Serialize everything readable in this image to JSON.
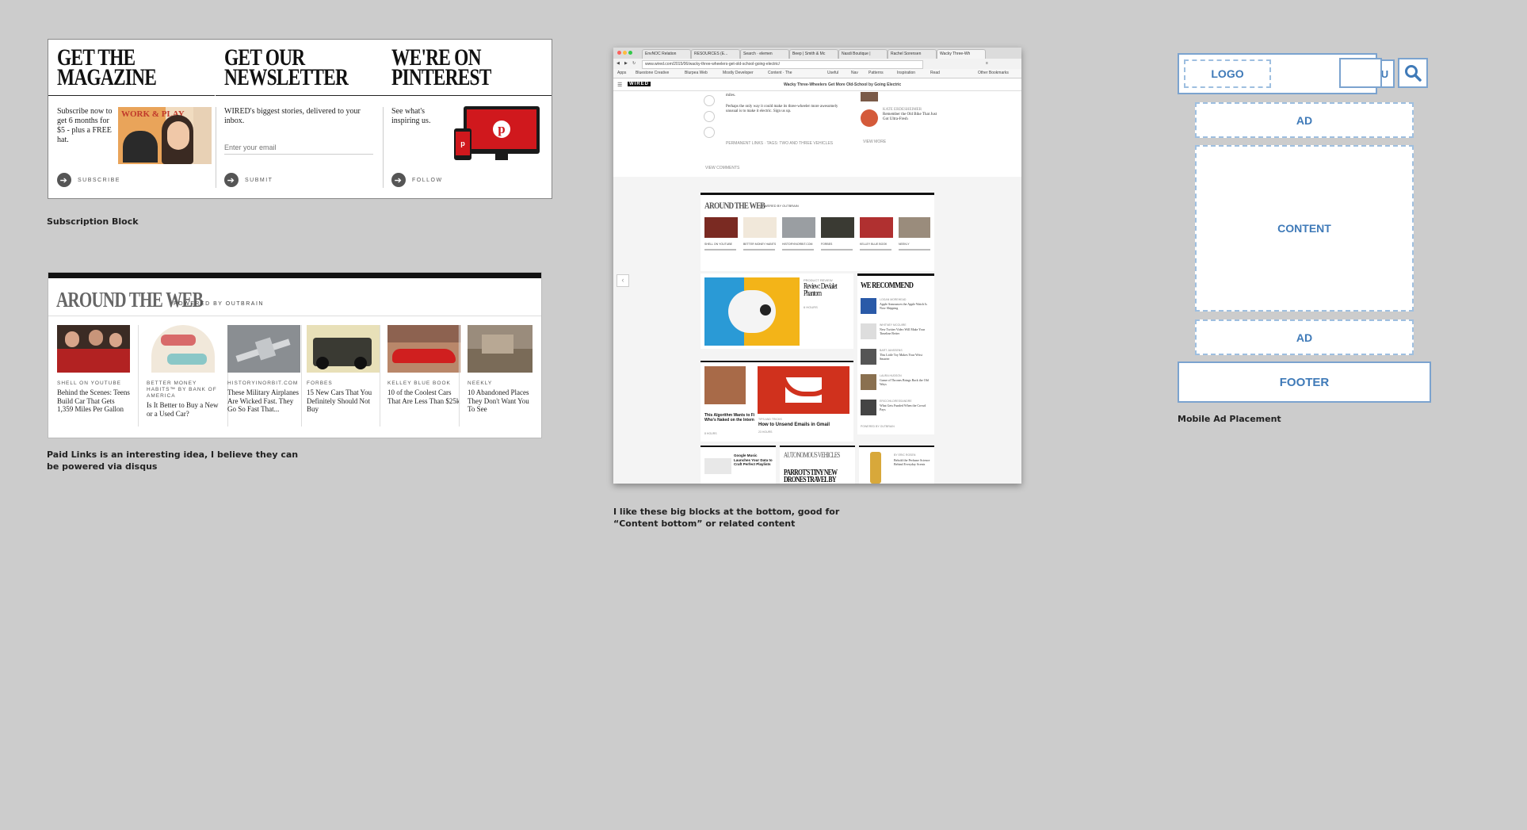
{
  "subscription_block": {
    "columns": [
      {
        "heading_line1": "GET THE",
        "heading_line2": "MAGAZINE",
        "text": "Subscribe now to get 6 months for $5 - plus a FREE hat.",
        "action": "SUBSCRIBE"
      },
      {
        "heading_line1": "GET OUR",
        "heading_line2": "NEWSLETTER",
        "text": "WIRED's biggest stories, delivered to your inbox.",
        "placeholder": "Enter your email",
        "action": "SUBMIT"
      },
      {
        "heading_line1": "WE'RE ON",
        "heading_line2": "PINTEREST",
        "text": "See what's inspiring us.",
        "action": "FOLLOW"
      }
    ],
    "magazine_cover_text": "WORK & PLAY",
    "caption": "Subscription Block"
  },
  "around_the_web": {
    "title": "AROUND THE WEB",
    "powered_by": "POWERED BY OUTBRAIN",
    "items": [
      {
        "source": "SHELL ON YOUTUBE",
        "title": "Behind the Scenes: Teens Build Car That Gets 1,359 Miles Per Gallon"
      },
      {
        "source": "BETTER MONEY HABITS™ BY BANK OF AMERICA",
        "title": "Is It Better to Buy a New or a Used Car?"
      },
      {
        "source": "HISTORYINORBIT.COM",
        "title": "These Military Airplanes Are Wicked Fast. They Go So Fast That..."
      },
      {
        "source": "FORBES",
        "title": "15 New Cars That You Definitely Should Not Buy"
      },
      {
        "source": "KELLEY BLUE BOOK",
        "title": "10 of the Coolest Cars That Are Less Than $25k"
      },
      {
        "source": "NEEKLY",
        "title": "10 Abandoned Places They Don't Want You To See"
      }
    ],
    "caption_line1": "Paid Links is an interesting idea, I believe they can",
    "caption_line2": "be powered via disqus"
  },
  "browser_screenshot": {
    "tabs": [
      "EnvNOC Relation",
      "RESOURCES (E...",
      "Search · elemen",
      "Beep | Smith & Mc",
      "Nasdi Boutique |",
      "Rachel Sorensen",
      "Wacky Three-Wh"
    ],
    "url": "www.wired.com/2015/06/wacky-three-wheelers-get-old-school-going-electric/",
    "bookmarks": [
      "Apps",
      "Bluestone Creative",
      "Blurpea Web",
      "Mostly Developer",
      "Content · The",
      "Useful",
      "Nav",
      "Patterns",
      "Inspiration",
      "Read",
      "Other Bookmarks"
    ],
    "site_logo": "WIRED",
    "article_title": "Wacky Three-Wheelers Get More Old-School by Going Electric",
    "body_text_1": "miles.",
    "body_text_2": "Perhaps the only way it could make its three-wheeler more awesomely unusual is to make it electric. Sign us up.",
    "tags": "PERMANENT LINKS · TAGS: TWO AND THREE VEHICLES",
    "view_comments": "VIEW COMMENTS",
    "view_more": "VIEW MORE",
    "side_list": [
      {
        "kicker": "GEAR",
        "title": "Maybe We'll Have Trek's Prototype Bike Pedal Better"
      },
      {
        "kicker": "KATE ERDESHEIMER",
        "title": "Remember the Old Bike That Just Got Ultra-Fresh"
      }
    ],
    "atw_title": "AROUND THE WEB",
    "atw_powered": "POWERED BY OUTBRAIN",
    "atw_sources": [
      "SHELL ON YOUTUBE",
      "BETTER MONEY HABITS",
      "HISTORYINORBIT.COM",
      "FORBES",
      "KELLEY BLUE BOOK",
      "NEEKLY"
    ],
    "feature_kicker": "PRODUCT REVIEW",
    "feature_title": "Review: Devialet Phantom",
    "feature_time": "6 HOURS",
    "we_recommend_title": "WE RECOMMEND",
    "we_recommend": [
      {
        "kicker": "LOGAN MOREHEAD",
        "title": "Apple Announces the Apple Watch Is Now Shipping"
      },
      {
        "kicker": "WHITNEY MCGUIRE",
        "title": "New Twitter Video Will Make Your Timeline Better"
      },
      {
        "kicker": "BART JANSSENS",
        "title": "This Little Toy Makes Your Wrist Smarter"
      },
      {
        "kicker": "LAURA HUDSON",
        "title": "Game of Thrones Brings Back the Old Ways"
      },
      {
        "kicker": "ERICCHILDRESSANDRE",
        "title": "What Gets Funded When the Crowd Pays"
      }
    ],
    "powered_small": "POWERED BY OUTBRAIN",
    "card_algorithm_title": "This Algorithm Wants to Find Who's Naked on the Internet",
    "card_algorithm_time": "8 HOURS",
    "card_gmail_kicker": "TIPS AND TRICKS",
    "card_gmail_title": "How to Unsend Emails in Gmail",
    "card_gmail_time": "23 HOURS",
    "card_google_title": "Google Music Launches Your Data to Craft Perfect Playlists",
    "card_auto_kicker": "AUTONOMOUS VEHICLES",
    "card_auto_title": "PARROT'S TINY NEW DRONES TRAVEL BY",
    "card_perfume_kicker": "BY ERIC ROSEN",
    "card_perfume_title": "Behold the Perfume Science Behind Everyday Scents",
    "caption_line1": "I like these big blocks at the bottom, good for",
    "caption_line2": "“Content bottom” or related content"
  },
  "mobile_wireframe": {
    "logo": "LOGO",
    "menu": "MENU",
    "ad_top": "AD",
    "content": "CONTENT",
    "ad_bottom": "AD",
    "footer": "FOOTER",
    "caption": "Mobile Ad Placement"
  },
  "colors": {
    "wireframe_blue": "#3f7ab8",
    "wireframe_border": "#7ba3cf",
    "pinterest_red": "#d0181d",
    "background": "#cccccc"
  }
}
